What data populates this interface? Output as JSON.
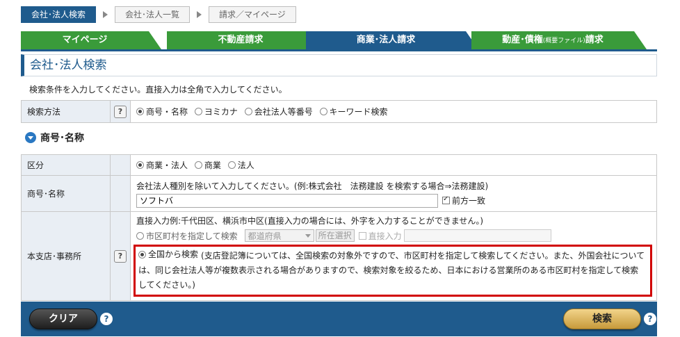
{
  "breadcrumb": [
    "会社･法人検索",
    "会社･法人一覧",
    "請求／マイページ"
  ],
  "tabs": {
    "mypage": "マイページ",
    "realestate": "不動産請求",
    "commercial": "商業･法人請求",
    "movables_main": "動産･債権",
    "movables_small": "(概要ファイル)",
    "movables_tail": "請求"
  },
  "page_title": "会社･法人検索",
  "intro": "検索条件を入力してください。直接入力は全角で入力してください。",
  "search_method": {
    "label": "検索方法",
    "options": [
      "商号・名称",
      "ヨミカナ",
      "会社法人等番号",
      "キーワード検索"
    ],
    "selected": 0
  },
  "section_title": "商号･名称",
  "category": {
    "label": "区分",
    "options": [
      "商業・法人",
      "商業",
      "法人"
    ],
    "selected": 0
  },
  "name": {
    "label": "商号･名称",
    "hint": "会社法人種別を除いて入力してください。(例:株式会社　法務建設 を検索する場合⇒法務建設)",
    "value": "ソフトバ",
    "prefix_match_label": "前方一致",
    "prefix_match_checked": true
  },
  "office": {
    "label": "本支店･事務所",
    "hint": "直接入力例:千代田区、横浜市中区(直接入力の場合には、外字を入力することができません。)",
    "city_option": "市区町村を指定して検索",
    "prefecture_placeholder": "都道府県",
    "location_select_label": "所在選択",
    "direct_input_label": "直接入力",
    "nationwide_option": "全国から検索",
    "nationwide_note": "(支店登記簿については、全国検索の対象外ですので、市区町村を指定して検索してください。また、外国会社については、同じ会社法人等が複数表示される場合がありますので、検索対象を絞るため、日本における営業所のある市区町村を指定して検索してください。)",
    "selected": "nationwide"
  },
  "footer": {
    "clear_label": "クリア",
    "search_label": "検索",
    "help_label": "?"
  },
  "colors": {
    "brand_blue": "#1f5b8d",
    "tab_green": "#3a9b3a",
    "highlight_red": "#d10000"
  }
}
